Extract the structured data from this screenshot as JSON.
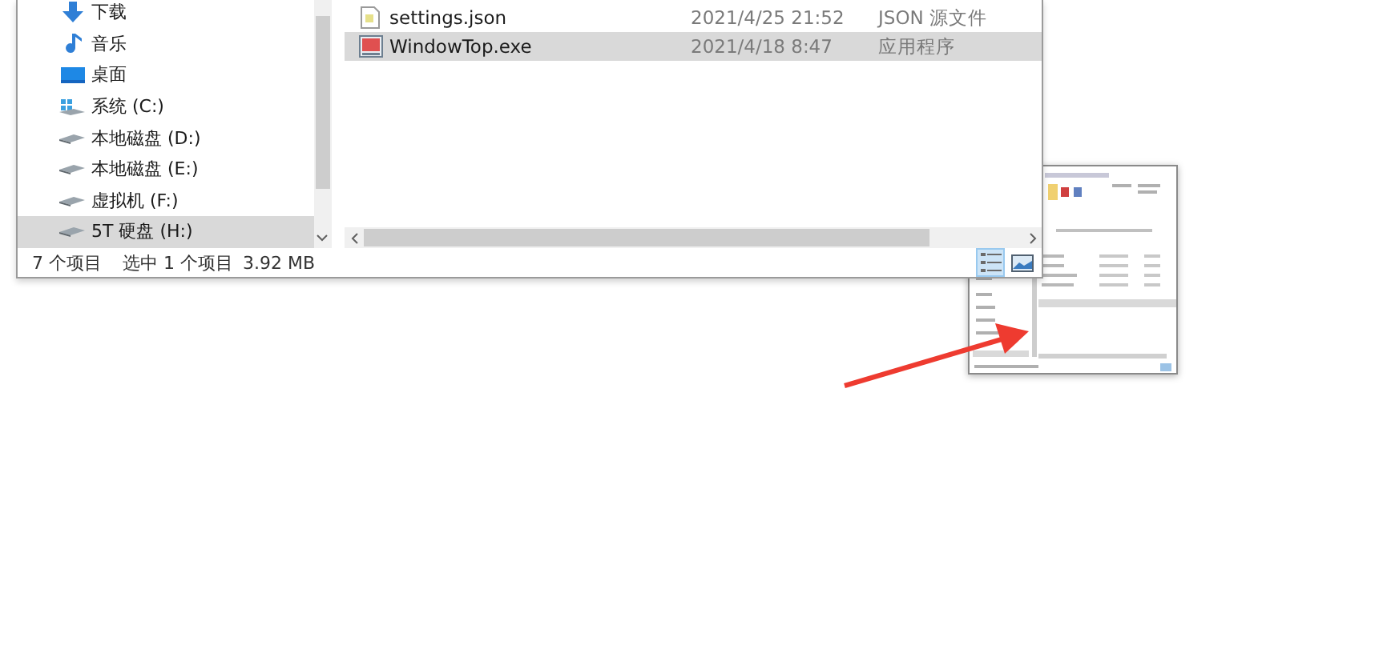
{
  "sidebar": {
    "items": [
      {
        "label": "下载",
        "kind": "download",
        "selected": false
      },
      {
        "label": "音乐",
        "kind": "music",
        "selected": false
      },
      {
        "label": "桌面",
        "kind": "desktop",
        "selected": false
      },
      {
        "label": "系统 (C:)",
        "kind": "system",
        "selected": false
      },
      {
        "label": "本地磁盘 (D:)",
        "kind": "drive",
        "selected": false
      },
      {
        "label": "本地磁盘 (E:)",
        "kind": "drive",
        "selected": false
      },
      {
        "label": "虚拟机 (F:)",
        "kind": "drive",
        "selected": false
      },
      {
        "label": "5T 硬盘 (H:)",
        "kind": "drive",
        "selected": true
      }
    ]
  },
  "files": {
    "rows": [
      {
        "name": "settings.json",
        "modified": "2021/4/25 21:52",
        "type": "JSON 源文件",
        "kind": "json",
        "selected": false
      },
      {
        "name": "WindowTop.exe",
        "modified": "2021/4/18 8:47",
        "type": "应用程序",
        "kind": "exe",
        "selected": true
      }
    ]
  },
  "status_bar": {
    "item_count": "7 个项目",
    "selection": "选中 1 个项目",
    "size": "3.92 MB"
  },
  "view_buttons": [
    {
      "kind": "details",
      "selected": true
    },
    {
      "kind": "large-icons",
      "selected": false
    }
  ]
}
